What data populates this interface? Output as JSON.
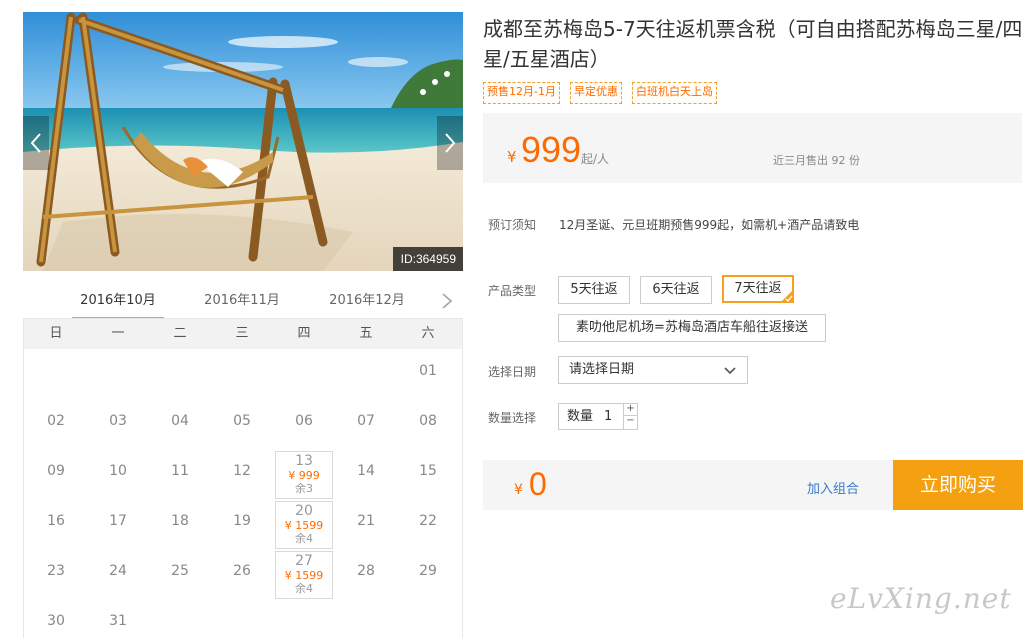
{
  "photo": {
    "id_label": "ID:364959",
    "prev_icon": "chevron-left-icon",
    "next_icon": "chevron-right-icon"
  },
  "calendar": {
    "months": [
      "2016年10月",
      "2016年11月",
      "2016年12月"
    ],
    "active_month_index": 0,
    "weekdays": [
      "日",
      "一",
      "二",
      "三",
      "四",
      "五",
      "六"
    ],
    "days": [
      {
        "d": "01",
        "col": 6,
        "row": 0
      },
      {
        "d": "02",
        "col": 0,
        "row": 1
      },
      {
        "d": "03",
        "col": 1,
        "row": 1
      },
      {
        "d": "04",
        "col": 2,
        "row": 1
      },
      {
        "d": "05",
        "col": 3,
        "row": 1
      },
      {
        "d": "06",
        "col": 4,
        "row": 1
      },
      {
        "d": "07",
        "col": 5,
        "row": 1
      },
      {
        "d": "08",
        "col": 6,
        "row": 1
      },
      {
        "d": "09",
        "col": 0,
        "row": 2
      },
      {
        "d": "10",
        "col": 1,
        "row": 2
      },
      {
        "d": "11",
        "col": 2,
        "row": 2
      },
      {
        "d": "12",
        "col": 3,
        "row": 2
      },
      {
        "d": "13",
        "col": 4,
        "row": 2,
        "price": "¥ 999",
        "stock": "余3"
      },
      {
        "d": "14",
        "col": 5,
        "row": 2
      },
      {
        "d": "15",
        "col": 6,
        "row": 2
      },
      {
        "d": "16",
        "col": 0,
        "row": 3
      },
      {
        "d": "17",
        "col": 1,
        "row": 3
      },
      {
        "d": "18",
        "col": 2,
        "row": 3
      },
      {
        "d": "19",
        "col": 3,
        "row": 3
      },
      {
        "d": "20",
        "col": 4,
        "row": 3,
        "price": "¥ 1599",
        "stock": "余4"
      },
      {
        "d": "21",
        "col": 5,
        "row": 3
      },
      {
        "d": "22",
        "col": 6,
        "row": 3
      },
      {
        "d": "23",
        "col": 0,
        "row": 4
      },
      {
        "d": "24",
        "col": 1,
        "row": 4
      },
      {
        "d": "25",
        "col": 2,
        "row": 4
      },
      {
        "d": "26",
        "col": 3,
        "row": 4
      },
      {
        "d": "27",
        "col": 4,
        "row": 4,
        "price": "¥ 1599",
        "stock": "余4"
      },
      {
        "d": "28",
        "col": 5,
        "row": 4
      },
      {
        "d": "29",
        "col": 6,
        "row": 4
      },
      {
        "d": "30",
        "col": 0,
        "row": 5
      },
      {
        "d": "31",
        "col": 1,
        "row": 5
      }
    ]
  },
  "product": {
    "title": "成都至苏梅岛5-7天往返机票含税（可自由搭配苏梅岛三星/四星/五星酒店）",
    "tags": [
      "预售12月-1月",
      "早定优惠",
      "白班机白天上岛"
    ],
    "price_currency": "¥",
    "price_value": "999",
    "price_unit": "起/人",
    "sold_text": "近三月售出 92 份"
  },
  "booking": {
    "notice_label": "预订须知",
    "notice_text": "12月圣诞、元旦班期预售999起，如需机+酒产品请致电",
    "type_label": "产品类型",
    "types": [
      "5天往返",
      "6天往返",
      "7天往返"
    ],
    "selected_type_index": 2,
    "transfer_option": "素叻他尼机场=苏梅岛酒店车船往返接送",
    "date_label": "选择日期",
    "date_placeholder": "请选择日期",
    "qty_label": "数量选择",
    "qty_prefix": "数量",
    "qty_value": "1",
    "qty_plus": "+",
    "qty_minus": "−"
  },
  "footer": {
    "total_currency": "¥",
    "total_value": "0",
    "add_combo": "加入组合",
    "buy_now": "立即购买"
  },
  "watermark": "eLvXing.net",
  "colors": {
    "accent": "#ff6a00",
    "button": "#f5a010",
    "link": "#3a7bc8"
  }
}
